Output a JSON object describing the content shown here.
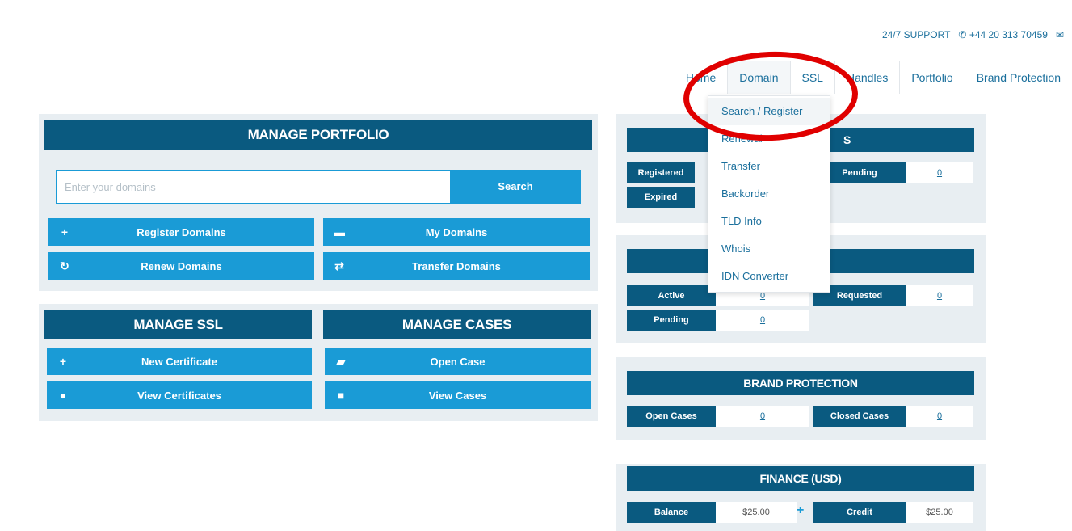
{
  "topbar": {
    "support_label": "24/7 SUPPORT",
    "phone": "+44 20 313 70459",
    "phone_icon": "phone-icon",
    "mail_icon": "mail-icon"
  },
  "nav": {
    "items": [
      "Home",
      "Domain",
      "SSL",
      "Handles",
      "Portfolio",
      "Brand Protection"
    ],
    "active": "Domain"
  },
  "dropdown": {
    "items": [
      "Search / Register",
      "Renewal",
      "Transfer",
      "Backorder",
      "TLD Info",
      "Whois",
      "IDN Converter"
    ],
    "highlighted": "Search / Register"
  },
  "manage_portfolio": {
    "title": "MANAGE PORTFOLIO",
    "search_placeholder": "Enter your domains",
    "search_button": "Search",
    "buttons": [
      {
        "label": "Register Domains",
        "icon": "plus-icon"
      },
      {
        "label": "My Domains",
        "icon": "briefcase-icon"
      },
      {
        "label": "Renew Domains",
        "icon": "refresh-icon"
      },
      {
        "label": "Transfer Domains",
        "icon": "exchange-icon"
      }
    ]
  },
  "manage_ssl": {
    "title": "MANAGE SSL",
    "buttons": [
      {
        "label": "New Certificate",
        "icon": "plus-icon"
      },
      {
        "label": "View Certificates",
        "icon": "circle-icon"
      }
    ]
  },
  "manage_cases": {
    "title": "MANAGE CASES",
    "buttons": [
      {
        "label": "Open Case",
        "icon": "folder-open-icon"
      },
      {
        "label": "View Cases",
        "icon": "folder-icon"
      }
    ]
  },
  "domains_panel": {
    "title_visible": "S",
    "registered_label": "Registered",
    "expired_label": "Expired",
    "pending_label": "Pending",
    "pending_value": "0"
  },
  "handles_panel": {
    "active_label": "Active",
    "active_value": "0",
    "requested_label": "Requested",
    "requested_value": "0",
    "pending_label": "Pending",
    "pending_value": "0"
  },
  "brand_protection": {
    "title": "BRAND PROTECTION",
    "open_label": "Open Cases",
    "open_value": "0",
    "closed_label": "Closed Cases",
    "closed_value": "0"
  },
  "finance": {
    "title": "FINANCE (USD)",
    "balance_label": "Balance",
    "balance_value": "$25.00",
    "credit_label": "Credit",
    "credit_value": "$25.00"
  },
  "colors": {
    "header_dark": "#0a5a80",
    "button_blue": "#1a9bd6",
    "panel_bg": "#e8eef2",
    "annotation_red": "#e00000"
  }
}
